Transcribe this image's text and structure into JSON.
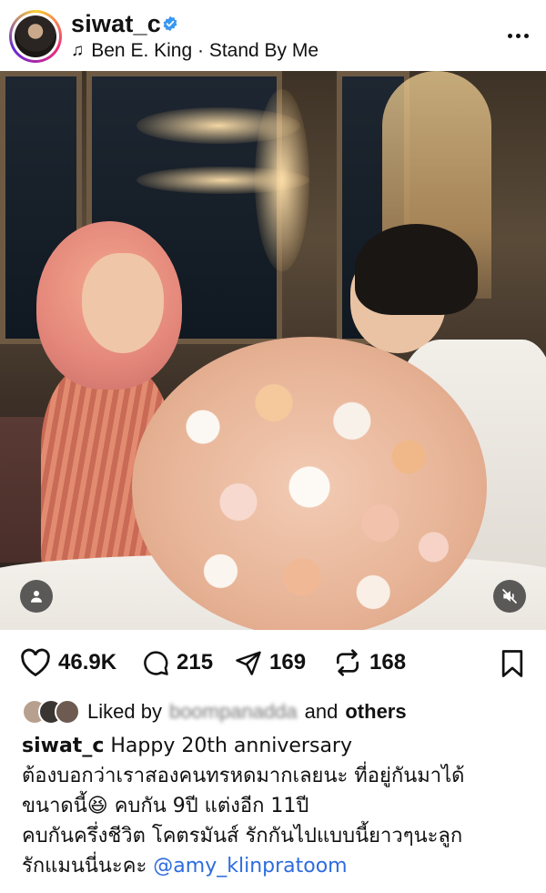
{
  "post": {
    "username": "siwat_c",
    "music": "Ben E. King · Stand By Me",
    "icons": {
      "verified": "verified-badge-icon",
      "music": "music-note-icon",
      "more": "more-options-icon"
    }
  },
  "actions": {
    "likes_count": "46.9K",
    "comments_count": "215",
    "shares_count": "169",
    "reposts_count": "168"
  },
  "liked_by": {
    "prefix": "Liked by",
    "name": "boompanadda",
    "connector": "and",
    "others": "others"
  },
  "caption": {
    "username": "siwat_c",
    "first_line": "Happy 20th anniversary",
    "line2": "ต้องบอกว่าเราสองคนทรหดมากเลยนะ ที่อยู่กันมาได้",
    "line3_a": "ขนาดนี้",
    "line3_emoji": "😆",
    "line3_b": " คบกัน 9ปี แต่งอีก 11ปี",
    "line4": "คบกันครึ่งชีวิต โคตรมันส์ รักกันไปแบบนี้ยาวๆนะลูก",
    "line5": "รักแมนนี่นะคะ",
    "mention": "@amy_klinpratoom"
  },
  "colors": {
    "verified": "#3897f0",
    "mention": "#2d6cdf",
    "text": "#111111"
  }
}
